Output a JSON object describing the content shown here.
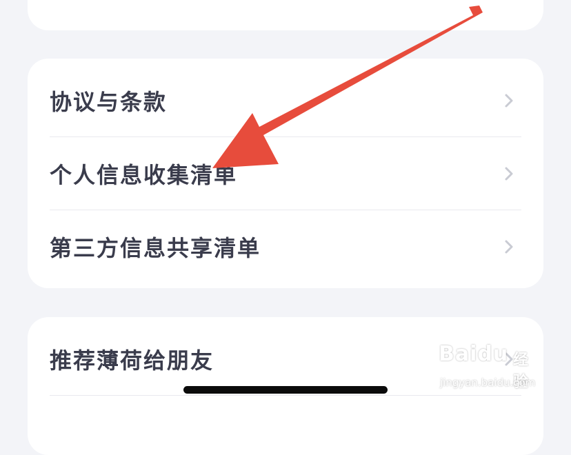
{
  "settings": {
    "group_legal": {
      "items": [
        {
          "label": "协议与条款"
        },
        {
          "label": "个人信息收集清单"
        },
        {
          "label": "第三方信息共享清单"
        }
      ]
    },
    "group_share": {
      "items": [
        {
          "label": "推荐薄荷给朋友"
        }
      ]
    }
  },
  "overlay": {
    "arrow_color": "#e74c3c",
    "icon": "chevron-right-icon"
  },
  "watermark": {
    "brand": "Baidu",
    "suffix": "经验",
    "url": "jingyan.baidu.com"
  },
  "colors": {
    "background": "#f3f4f8",
    "card": "#ffffff",
    "text": "#3a3c4c",
    "chevron": "#c9cbd3",
    "divider": "#e9e9ee"
  }
}
